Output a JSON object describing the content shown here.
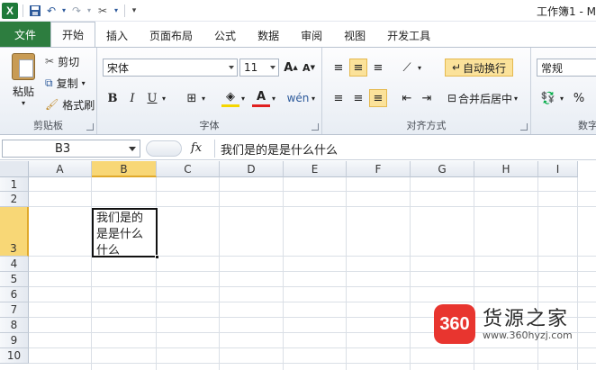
{
  "titlebar": {
    "title": "工作簿1 - M"
  },
  "tabs": [
    "文件",
    "开始",
    "插入",
    "页面布局",
    "公式",
    "数据",
    "审阅",
    "视图",
    "开发工具"
  ],
  "ribbon": {
    "clipboard": {
      "paste": "粘贴",
      "cut": "剪切",
      "copy": "复制",
      "format_painter": "格式刷",
      "label": "剪贴板"
    },
    "font": {
      "font_name": "宋体",
      "font_size": "11",
      "bold": "B",
      "italic": "I",
      "underline": "U",
      "label": "字体"
    },
    "alignment": {
      "wrap_text": "自动换行",
      "merge_center": "合并后居中",
      "label": "对齐方式"
    },
    "number": {
      "format": "常规",
      "percent": "%",
      "label": "数字"
    }
  },
  "formula_bar": {
    "name_box": "B3",
    "fx": "fx",
    "content": "我们是的是是什么什么"
  },
  "grid": {
    "columns": [
      "A",
      "B",
      "C",
      "D",
      "E",
      "F",
      "G",
      "H",
      "I"
    ],
    "rows": [
      "1",
      "2",
      "3",
      "4",
      "5",
      "6",
      "7",
      "8",
      "9",
      "10"
    ],
    "active_cell_text": "我们是的是是什么什么"
  },
  "watermark": {
    "logo": "360",
    "name": "货源之家",
    "url": "www.360hyzj.com"
  },
  "colors": {
    "file_tab": "#2d7d3f",
    "selection_header": "#f8d776",
    "highlight_button": "#fbe29a"
  }
}
